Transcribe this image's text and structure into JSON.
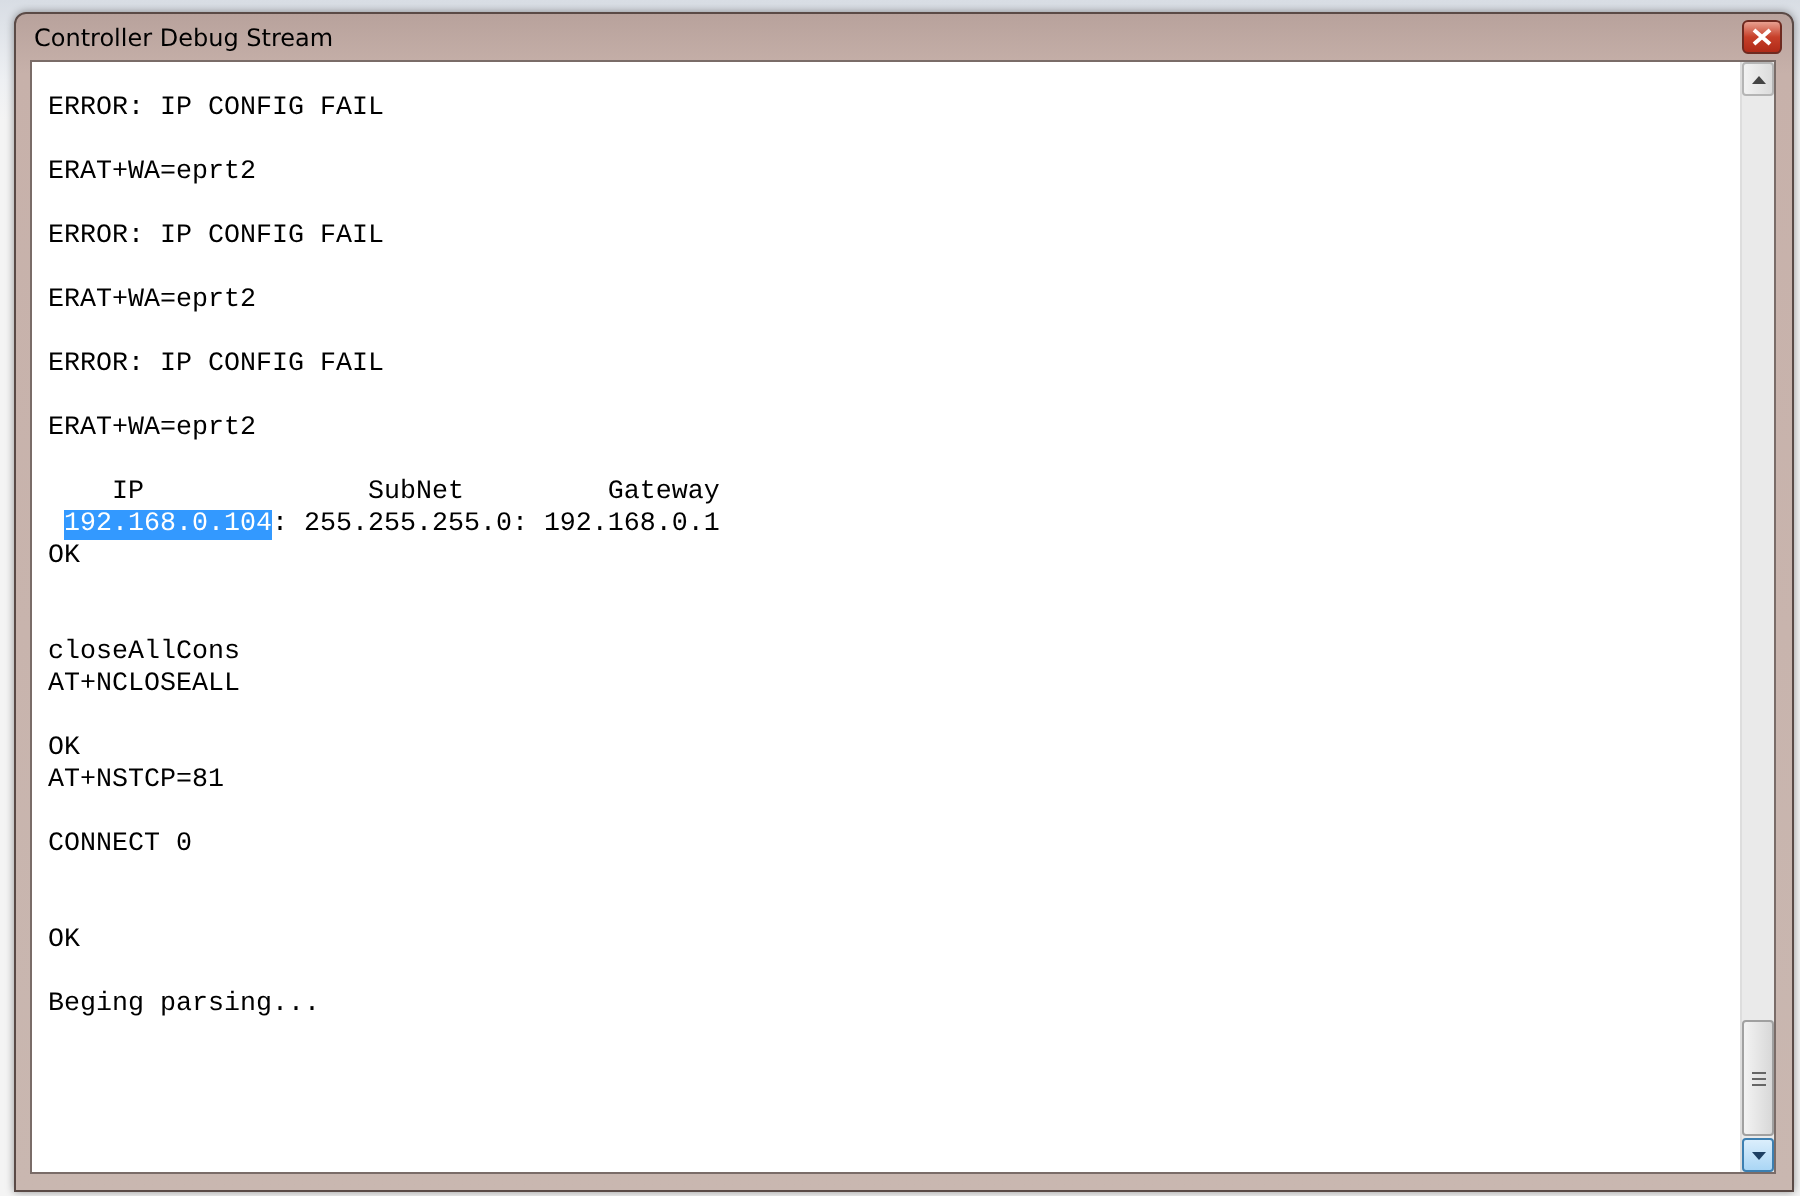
{
  "window": {
    "title": "Controller Debug Stream"
  },
  "log": [
    {
      "kind": "blank"
    },
    {
      "kind": "text",
      "text": "ERROR: IP CONFIG FAIL"
    },
    {
      "kind": "blank"
    },
    {
      "kind": "text",
      "text": "ERAT+WA=eprt2"
    },
    {
      "kind": "blank"
    },
    {
      "kind": "text",
      "text": "ERROR: IP CONFIG FAIL"
    },
    {
      "kind": "blank"
    },
    {
      "kind": "text",
      "text": "ERAT+WA=eprt2"
    },
    {
      "kind": "blank"
    },
    {
      "kind": "text",
      "text": "ERROR: IP CONFIG FAIL"
    },
    {
      "kind": "blank"
    },
    {
      "kind": "text",
      "text": "ERAT+WA=eprt2"
    },
    {
      "kind": "blank"
    },
    {
      "kind": "text",
      "text": "    IP              SubNet         Gateway"
    },
    {
      "kind": "segments",
      "segments": [
        {
          "text": "192.168.0.104",
          "selected": true
        },
        {
          "text": ": 255.255.255.0: 192.168.0.1",
          "selected": false
        }
      ]
    },
    {
      "kind": "text",
      "text": "OK"
    },
    {
      "kind": "blank"
    },
    {
      "kind": "blank"
    },
    {
      "kind": "text",
      "text": "closeAllCons"
    },
    {
      "kind": "text",
      "text": "AT+NCLOSEALL"
    },
    {
      "kind": "blank"
    },
    {
      "kind": "text",
      "text": "OK"
    },
    {
      "kind": "text",
      "text": "AT+NSTCP=81"
    },
    {
      "kind": "blank"
    },
    {
      "kind": "text",
      "text": "CONNECT 0"
    },
    {
      "kind": "blank"
    },
    {
      "kind": "blank"
    },
    {
      "kind": "text",
      "text": "OK"
    },
    {
      "kind": "blank"
    },
    {
      "kind": "text",
      "text": "Beging parsing..."
    }
  ]
}
